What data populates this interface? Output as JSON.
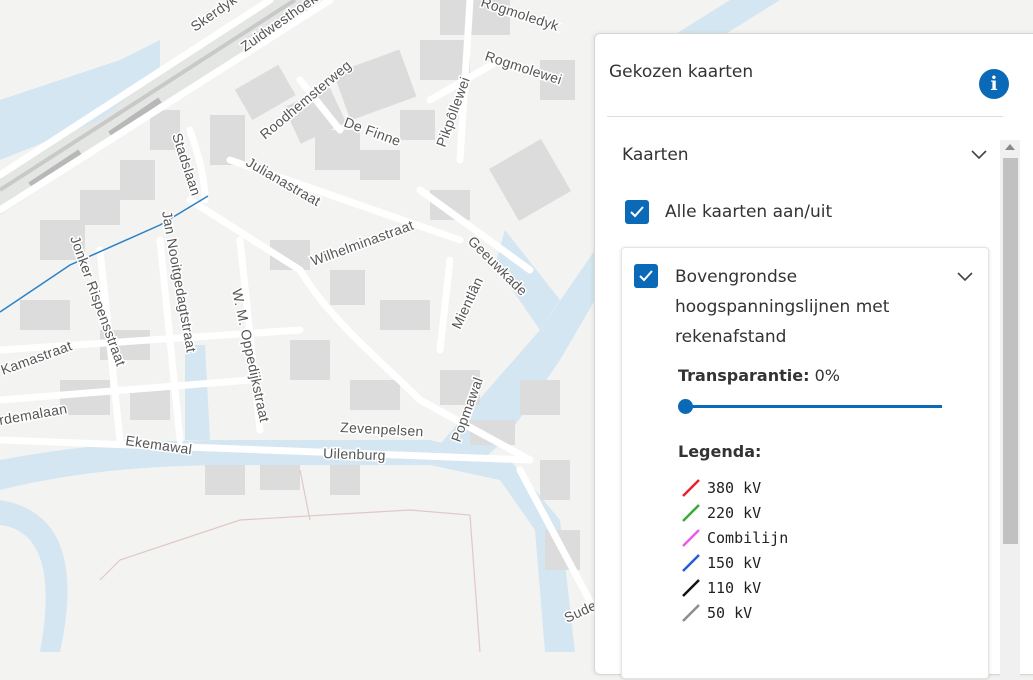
{
  "map": {
    "street_labels": [
      "Skerdyk",
      "Zuidwesthoek",
      "Rogmoledyk",
      "Rogmolewei",
      "Roodhemsterweg",
      "De Finne",
      "Pikpôllewei",
      "Stadslaan",
      "Julianastraat",
      "Wilhelminastraat",
      "Geeuwkade",
      "Jan Nooitgedagtstraat",
      "Jonker Rispensstraat",
      "Kamastraat",
      "W. M. Oppedijkstraat",
      "Mientlân",
      "Popmawal",
      "Zevenpelsen",
      "Ekemawal",
      "Uilenburg",
      "rdemalaan",
      "Sude"
    ]
  },
  "panel": {
    "title": "Gekozen kaarten",
    "info_icon": "info-icon",
    "section_title": "Kaarten",
    "toggle_all_label": "Alle kaarten aan/uit",
    "toggle_all_checked": true,
    "layer": {
      "name": "Bovengrondse hoogspanningslijnen met rekenafstand",
      "checked": true,
      "transparency_label": "Transparantie:",
      "transparency_value": "0%",
      "transparency_level": 0,
      "legend_title": "Legenda:",
      "legend": [
        {
          "label": "380 kV",
          "color": "#e8202a"
        },
        {
          "label": "220 kV",
          "color": "#3aaa35"
        },
        {
          "label": "Combilijn",
          "color": "#e75ce8"
        },
        {
          "label": "150 kV",
          "color": "#1f5fd6"
        },
        {
          "label": "110 kV",
          "color": "#111111"
        },
        {
          "label": "50 kV",
          "color": "#8c8c8c"
        }
      ]
    }
  },
  "colors": {
    "accent": "#0a6ab8",
    "water": "#d4e6f1",
    "building": "#dcdcdc",
    "background": "#f3f3f1",
    "power_line": "#2b7fc4"
  }
}
